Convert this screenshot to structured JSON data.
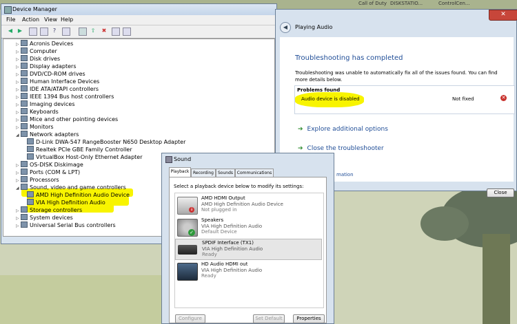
{
  "device_manager": {
    "title": "Device Manager",
    "menu": [
      "File",
      "Action",
      "View",
      "Help"
    ],
    "tree": [
      {
        "label": "Acronis Devices",
        "level": 1
      },
      {
        "label": "Computer",
        "level": 1
      },
      {
        "label": "Disk drives",
        "level": 1
      },
      {
        "label": "Display adapters",
        "level": 1
      },
      {
        "label": "DVD/CD-ROM drives",
        "level": 1
      },
      {
        "label": "Human Interface Devices",
        "level": 1
      },
      {
        "label": "IDE ATA/ATAPI controllers",
        "level": 1
      },
      {
        "label": "IEEE 1394 Bus host controllers",
        "level": 1
      },
      {
        "label": "Imaging devices",
        "level": 1
      },
      {
        "label": "Keyboards",
        "level": 1
      },
      {
        "label": "Mice and other pointing devices",
        "level": 1
      },
      {
        "label": "Monitors",
        "level": 1
      },
      {
        "label": "Network adapters",
        "level": 1
      },
      {
        "label": "D-Link DWA-547 RangeBooster N650 Desktop Adapter",
        "level": 2
      },
      {
        "label": "Realtek PCIe GBE Family Controller",
        "level": 2
      },
      {
        "label": "VirtualBox Host-Only Ethernet Adapter",
        "level": 2
      },
      {
        "label": "OS-DISK Diskimage",
        "level": 1
      },
      {
        "label": "Ports (COM & LPT)",
        "level": 1
      },
      {
        "label": "Processors",
        "level": 1
      },
      {
        "label": "Sound, video and game controllers",
        "level": 1
      },
      {
        "label": "AMD High Definition Audio Device",
        "level": 2
      },
      {
        "label": "VIA High Definition Audio",
        "level": 2
      },
      {
        "label": "Storage controllers",
        "level": 1
      },
      {
        "label": "System devices",
        "level": 1
      },
      {
        "label": "Universal Serial Bus controllers",
        "level": 1
      }
    ]
  },
  "troubleshooter": {
    "title": "Playing Audio",
    "headline": "Troubleshooting has completed",
    "description": "Troubleshooting was unable to automatically fix all of the issues found. You can find more details below.",
    "problems_header": "Problems found",
    "problem": "Audio device is disabled",
    "problem_status": "Not fixed",
    "action_explore": "Explore additional options",
    "action_close": "Close the troubleshooter",
    "info_link": "mation",
    "close_button": "Close"
  },
  "sound": {
    "title": "Sound",
    "tabs": [
      "Playback",
      "Recording",
      "Sounds",
      "Communications"
    ],
    "instruction": "Select a playback device below to modify its settings:",
    "devices": [
      {
        "name": "AMD HDMI Output",
        "driver": "AMD High Definition Audio Device",
        "status": "Not plugged in"
      },
      {
        "name": "Speakers",
        "driver": "VIA High Definition Audio",
        "status": "Default Device"
      },
      {
        "name": "SPDIF Interface (TX1)",
        "driver": "VIA High Definition Audio",
        "status": "Ready"
      },
      {
        "name": "HD Audio HDMI out",
        "driver": "VIA High Definition Audio",
        "status": "Ready"
      }
    ],
    "buttons": {
      "configure": "Configure",
      "set_default": "Set Default",
      "properties": "Properties"
    }
  },
  "taskbar_labels": [
    "Call of Duty",
    "DISKSTATIO...",
    "ControlCen..."
  ],
  "colors": {
    "highlight": "#ffff00",
    "link": "#1e4c96",
    "title_blue": "#1e4c96"
  }
}
